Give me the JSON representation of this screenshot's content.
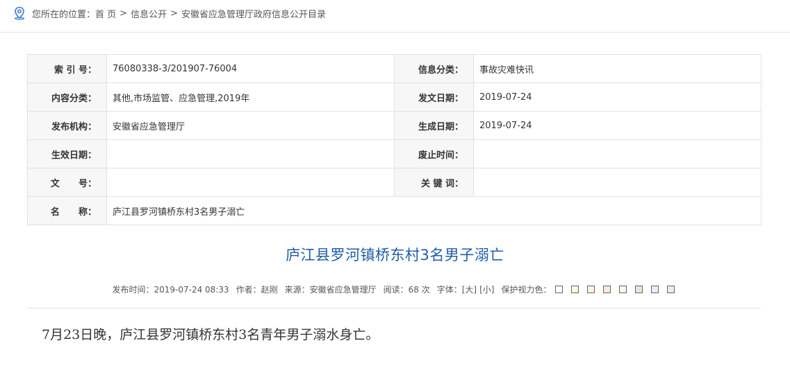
{
  "breadcrumb": {
    "prefix": "您所在的位置：",
    "items": [
      "首 页",
      "信息公开",
      "安徽省应急管理厅政府信息公开目录"
    ],
    "sep": ">"
  },
  "meta": {
    "rows": [
      {
        "l1": "索 引 号：",
        "v1": "76080338-3/201907-76004",
        "l2": "信息分类：",
        "v2": "事故灾难快讯"
      },
      {
        "l1": "内容分类：",
        "v1": "其他,市场监管、应急管理,2019年",
        "l2": "发文日期：",
        "v2": "2019-07-24"
      },
      {
        "l1": "发布机构：",
        "v1": "安徽省应急管理厅",
        "l2": "生成日期：",
        "v2": "2019-07-24"
      },
      {
        "l1": "生效日期：",
        "v1": "",
        "l2": "废止时间：",
        "v2": ""
      },
      {
        "l1": "文      号：",
        "v1": "",
        "l2": "关 键 词：",
        "v2": ""
      }
    ],
    "name_label": "名      称：",
    "name_value": "庐江县罗河镇桥东村3名男子溺亡"
  },
  "article": {
    "title": "庐江县罗河镇桥东村3名男子溺亡",
    "publish_time": "发布时间：2019-07-24 08:33",
    "author": "作者：赵刚",
    "source": "来源：安徽省应急管理厅",
    "views": "阅读：68 次",
    "font_label": "字体：",
    "font_large": "[大]",
    "font_small": "[小]",
    "eye_label": "保护视力色：",
    "body": "7月23日晚，庐江县罗河镇桥东村3名青年男子溺水身亡。"
  },
  "colors": {
    "title": "#1e5ca9",
    "icon": "#3a7bd5",
    "swatches": [
      "#ffffff",
      "#faf9de",
      "#fff2e2",
      "#fde6e0",
      "#f3ffe3",
      "#dcebe2",
      "#e9ebfe",
      "#eaeaef"
    ]
  }
}
